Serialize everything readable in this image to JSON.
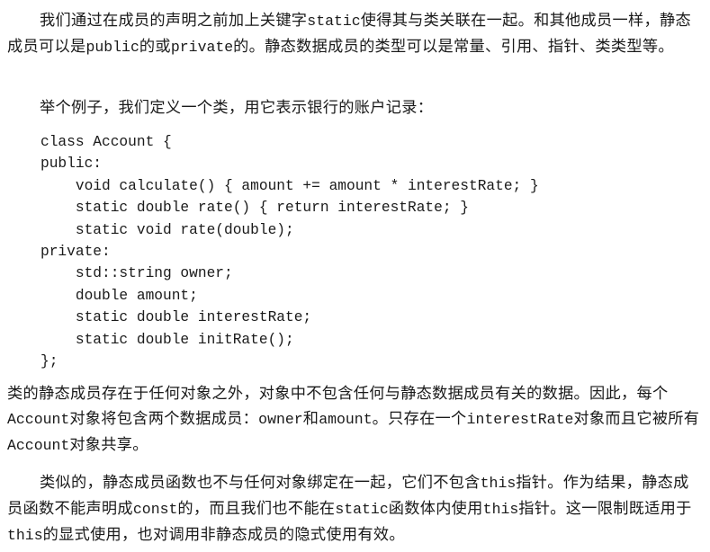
{
  "paragraphs": {
    "p1": {
      "s1": "我们通过在成员的声明之前加上关键字",
      "c1": "static",
      "s2": "使得其与类关联在一起。和其他成员一样，静态成员可以是",
      "c2": "public",
      "s3": "的或",
      "c3": "private",
      "s4": "的。静态数据成员的类型可以是常量、引用、指针、类类型等。"
    },
    "p2": {
      "s1": "举个例子，我们定义一个类，用它表示银行的账户记录："
    },
    "p3": {
      "s1": "类的静态成员存在于任何对象之外，对象中不包含任何与静态数据成员有关的数据。因此，每个",
      "c1": "Account",
      "s2": "对象将包含两个数据成员：",
      "c2": "owner",
      "s3": "和",
      "c3": "amount",
      "s4": "。只存在一个",
      "c4": "interestRate",
      "s5": "对象而且它被所有",
      "c5": "Account",
      "s6": "对象共享。"
    },
    "p4": {
      "s1": "类似的，静态成员函数也不与任何对象绑定在一起，它们不包含",
      "c1": "this",
      "s2": "指针。作为结果，静态成员函数不能声明成",
      "c2": "const",
      "s3": "的，而且我们也不能在",
      "c3": "static",
      "s4": "函数体内使用",
      "c4": "this",
      "s5": "指针。这一限制既适用于",
      "c5": "this",
      "s6": "的显式使用，也对调用非静态成员的隐式使用有效。"
    }
  },
  "code_listing": [
    "class Account {",
    "public:",
    "    void calculate() { amount += amount * interestRate; }",
    "    static double rate() { return interestRate; }",
    "    static void rate(double);",
    "private:",
    "    std::string owner;",
    "    double amount;",
    "    static double interestRate;",
    "    static double initRate();",
    "};"
  ]
}
